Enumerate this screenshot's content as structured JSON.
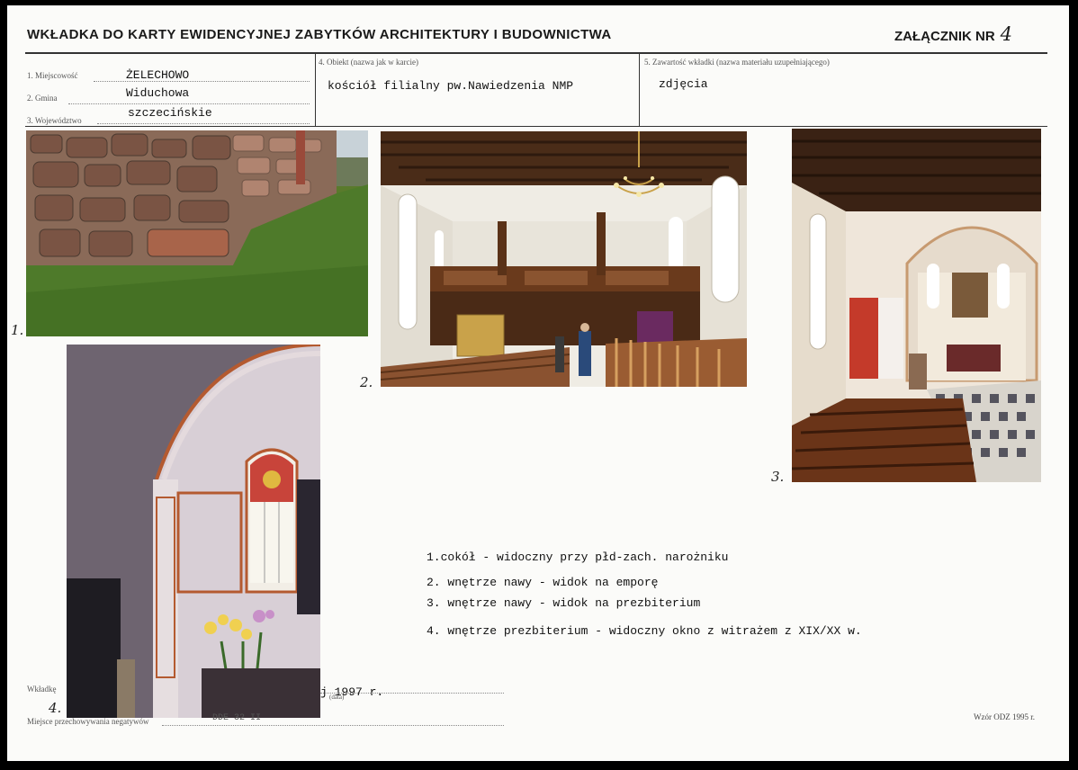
{
  "header": {
    "title": "WKŁADKA DO KARTY EWIDENCYJNEJ ZABYTKÓW ARCHITEKTURY I BUDOWNICTWA",
    "annex_label": "ZAŁĄCZNIK NR",
    "annex_number": "4"
  },
  "fields": {
    "locality_label": "1. Miejscowość",
    "locality_value": "ŻELECHOWO",
    "commune_label": "2. Gmina",
    "commune_value": "Widuchowa",
    "voivodeship_label": "3. Województwo",
    "voivodeship_value": "szczecińskie",
    "object_label": "4. Obiekt  (nazwa jak w karcie)",
    "object_value": "kościół filialny pw.Nawiedzenia NMP",
    "contents_label": "5. Zawartość wkładki  (nazwa materiału uzupełniającego)",
    "contents_value": "zdjęcia"
  },
  "photos": [
    {
      "number": "1.",
      "subject": "cokół"
    },
    {
      "number": "2.",
      "subject": "wnętrze nawy - widok na emporę"
    },
    {
      "number": "3.",
      "subject": "wnętrze nawy - widok na prezbiterium"
    },
    {
      "number": "4.",
      "subject": "wnętrze prezbiterium"
    }
  ],
  "captions": [
    "1.cokół - widoczny przy płd-zach. narożniku",
    "2. wnętrze nawy - widok na emporę",
    "3. wnętrze nawy - widok na prezbiterium",
    "4. wnętrze prezbiterium - widoczny okno z witrażem z XIX/XX w."
  ],
  "footer": {
    "insert_label": "Wkładkę",
    "date_partial": "j 1997 r.",
    "date_small_label": "(data)",
    "negatives_label": "Miejsce przechowywania negatywów",
    "negatives_value_partial": "DDE 32 II",
    "form_version": "Wzór ODZ 1995 r."
  }
}
